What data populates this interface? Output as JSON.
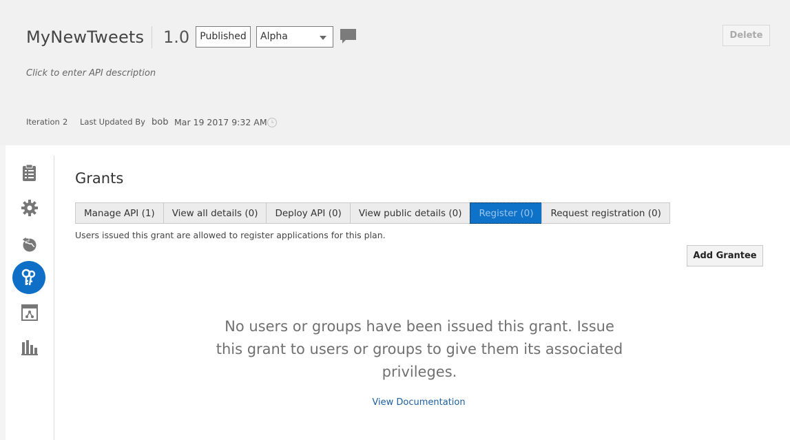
{
  "header": {
    "api_name": "MyNewTweets",
    "version": "1.0",
    "published_label": "Published",
    "state_selected": "Alpha",
    "delete_label": "Delete",
    "description_placeholder": "Click to enter API description",
    "iteration_label": "Iteration",
    "iteration_value": "2",
    "last_updated_label": "Last Updated By",
    "last_updated_user": "bob",
    "last_updated_time": "Mar 19 2017 9:32 AM"
  },
  "nav": {
    "items": [
      {
        "icon": "clipboard-icon"
      },
      {
        "icon": "gear-icon"
      },
      {
        "icon": "globe-deploy-icon"
      },
      {
        "icon": "keys-icon",
        "active": true
      },
      {
        "icon": "application-icon"
      },
      {
        "icon": "analytics-bar-chart-icon"
      }
    ]
  },
  "grants": {
    "title": "Grants",
    "tabs": [
      {
        "label": "Manage API (1)"
      },
      {
        "label": "View all details (0)"
      },
      {
        "label": "Deploy API (0)"
      },
      {
        "label": "View public details (0)"
      },
      {
        "label": "Register (0)",
        "selected": true
      },
      {
        "label": "Request registration (0)"
      }
    ],
    "tab_description": "Users issued this grant are allowed to register applications for this plan.",
    "add_grantee_label": "Add Grantee",
    "empty_message": "No users or groups have been issued this grant. Issue this grant to users or groups to give them its associated privileges.",
    "view_documentation_label": "View Documentation"
  },
  "colors": {
    "accent": "#0f6fc6",
    "header_bg": "#f1f1f1",
    "link": "#1b5f9f"
  }
}
